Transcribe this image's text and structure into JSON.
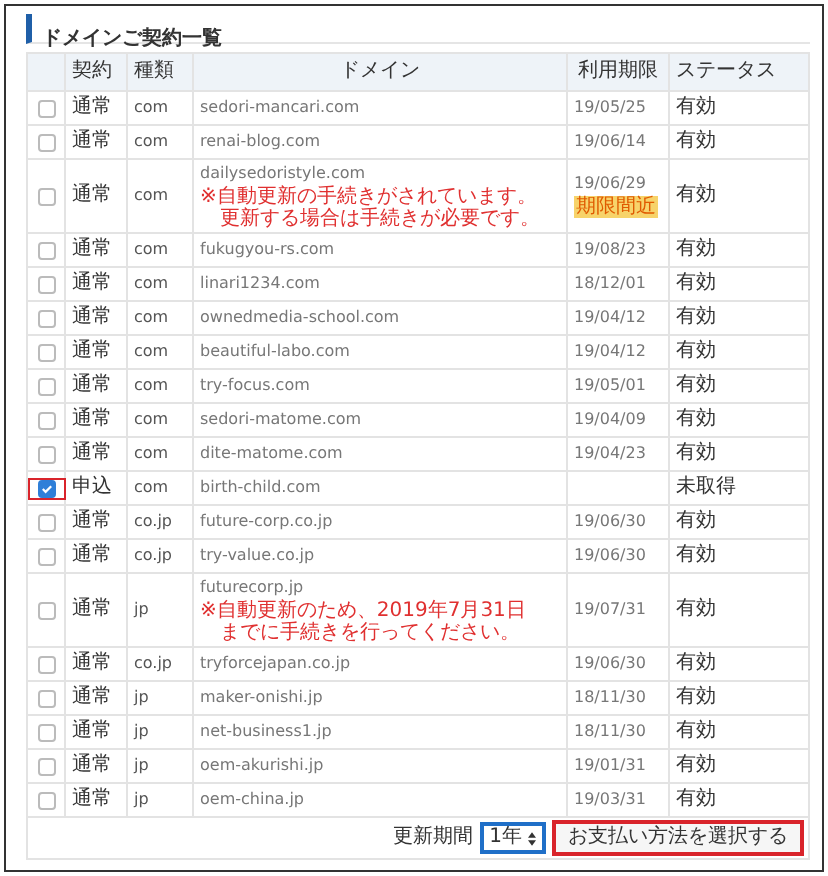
{
  "title": "ドメインご契約一覧",
  "columns": [
    "",
    "契約",
    "種類",
    "ドメイン",
    "利用期限",
    "ステータス"
  ],
  "rows": [
    {
      "checked": false,
      "highlighted": false,
      "contract": "通常",
      "type": "com",
      "domain": "sedori-mancari.com",
      "expiry": "19/05/25",
      "status": "有効"
    },
    {
      "checked": false,
      "highlighted": false,
      "contract": "通常",
      "type": "com",
      "domain": "renai-blog.com",
      "expiry": "19/06/14",
      "status": "有効"
    },
    {
      "checked": false,
      "highlighted": false,
      "contract": "通常",
      "type": "com",
      "domain": "dailysedoristyle.com",
      "notes": [
        "※自動更新の手続きがされています。",
        "更新する場合は手続きが必要です。"
      ],
      "expiry": "19/06/29",
      "badge": "期限間近",
      "status": "有効"
    },
    {
      "checked": false,
      "highlighted": false,
      "contract": "通常",
      "type": "com",
      "domain": "fukugyou-rs.com",
      "expiry": "19/08/23",
      "status": "有効"
    },
    {
      "checked": false,
      "highlighted": false,
      "contract": "通常",
      "type": "com",
      "domain": "linari1234.com",
      "expiry": "18/12/01",
      "status": "有効"
    },
    {
      "checked": false,
      "highlighted": false,
      "contract": "通常",
      "type": "com",
      "domain": "ownedmedia-school.com",
      "expiry": "19/04/12",
      "status": "有効"
    },
    {
      "checked": false,
      "highlighted": false,
      "contract": "通常",
      "type": "com",
      "domain": "beautiful-labo.com",
      "expiry": "19/04/12",
      "status": "有効"
    },
    {
      "checked": false,
      "highlighted": false,
      "contract": "通常",
      "type": "com",
      "domain": "try-focus.com",
      "expiry": "19/05/01",
      "status": "有効"
    },
    {
      "checked": false,
      "highlighted": false,
      "contract": "通常",
      "type": "com",
      "domain": "sedori-matome.com",
      "expiry": "19/04/09",
      "status": "有効"
    },
    {
      "checked": false,
      "highlighted": false,
      "contract": "通常",
      "type": "com",
      "domain": "dite-matome.com",
      "expiry": "19/04/23",
      "status": "有効"
    },
    {
      "checked": true,
      "highlighted": true,
      "contract": "申込",
      "type": "com",
      "domain": "birth-child.com",
      "expiry": "",
      "status": "未取得"
    },
    {
      "checked": false,
      "highlighted": false,
      "contract": "通常",
      "type": "co.jp",
      "domain": "future-corp.co.jp",
      "expiry": "19/06/30",
      "status": "有効"
    },
    {
      "checked": false,
      "highlighted": false,
      "contract": "通常",
      "type": "co.jp",
      "domain": "try-value.co.jp",
      "expiry": "19/06/30",
      "status": "有効"
    },
    {
      "checked": false,
      "highlighted": false,
      "contract": "通常",
      "type": "jp",
      "domain": "futurecorp.jp",
      "notes": [
        "※自動更新のため、2019年7月31日",
        "までに手続きを行ってください。"
      ],
      "expiry": "19/07/31",
      "status": "有効"
    },
    {
      "checked": false,
      "highlighted": false,
      "contract": "通常",
      "type": "co.jp",
      "domain": "tryforcejapan.co.jp",
      "expiry": "19/06/30",
      "status": "有効"
    },
    {
      "checked": false,
      "highlighted": false,
      "contract": "通常",
      "type": "jp",
      "domain": "maker-onishi.jp",
      "expiry": "18/11/30",
      "status": "有効"
    },
    {
      "checked": false,
      "highlighted": false,
      "contract": "通常",
      "type": "jp",
      "domain": "net-business1.jp",
      "expiry": "18/11/30",
      "status": "有効"
    },
    {
      "checked": false,
      "highlighted": false,
      "contract": "通常",
      "type": "jp",
      "domain": "oem-akurishi.jp",
      "expiry": "19/01/31",
      "status": "有効"
    },
    {
      "checked": false,
      "highlighted": false,
      "contract": "通常",
      "type": "jp",
      "domain": "oem-china.jp",
      "expiry": "19/03/31",
      "status": "有効"
    }
  ],
  "footer": {
    "label": "更新期間",
    "period": {
      "value": "1年",
      "focused": true
    },
    "button": {
      "label": "お支払い方法を選択する",
      "highlighted": true
    }
  }
}
